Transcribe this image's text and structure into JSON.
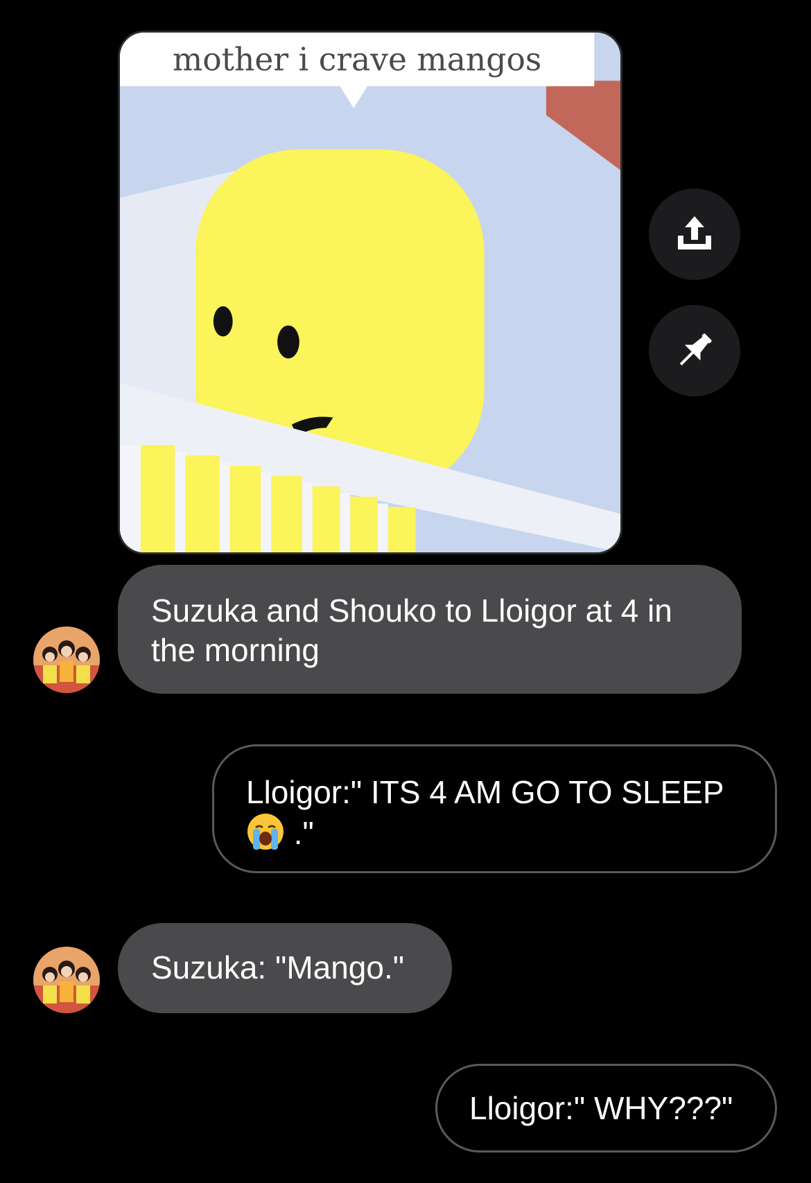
{
  "conversation": {
    "image_message": {
      "caption_text": "mother i crave mangos"
    },
    "actions": {
      "share_icon": "share-upload-icon",
      "pin_icon": "pin-icon"
    },
    "messages": [
      {
        "direction": "incoming",
        "text": "Suzuka and Shouko to Lloigor at 4 in the morning"
      },
      {
        "direction": "outgoing",
        "text_before_emoji": "Lloigor:\" ITS 4 AM GO TO SLEEP",
        "emoji": "loudly-crying-face",
        "text_after_emoji": " .\""
      },
      {
        "direction": "incoming",
        "text": "Suzuka: \"Mango.\""
      },
      {
        "direction": "outgoing",
        "text": "Lloigor:\" WHY???\""
      }
    ]
  },
  "colors": {
    "background": "#000000",
    "incoming_bubble": "#4a4a4d",
    "outgoing_border": "#5a5a5e"
  }
}
